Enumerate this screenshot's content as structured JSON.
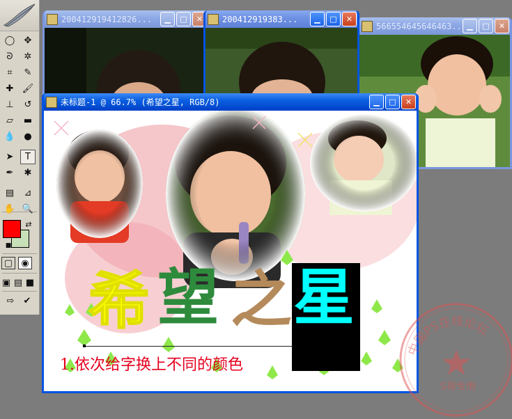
{
  "toolbox": {
    "tools": [
      {
        "name": "marquee-tool-icon",
        "glyph": "◯"
      },
      {
        "name": "move-tool-icon",
        "glyph": "✥"
      },
      {
        "name": "lasso-tool-icon",
        "glyph": "ᘐ"
      },
      {
        "name": "magic-wand-tool-icon",
        "glyph": "✲"
      },
      {
        "name": "crop-tool-icon",
        "glyph": "⌗"
      },
      {
        "name": "slice-tool-icon",
        "glyph": "✎"
      },
      {
        "name": "healing-brush-icon",
        "glyph": "✚"
      },
      {
        "name": "brush-tool-icon",
        "glyph": "🖌"
      },
      {
        "name": "clone-stamp-icon",
        "glyph": "⊥"
      },
      {
        "name": "history-brush-icon",
        "glyph": "↺"
      },
      {
        "name": "eraser-tool-icon",
        "glyph": "▱"
      },
      {
        "name": "gradient-tool-icon",
        "glyph": "▬"
      },
      {
        "name": "blur-tool-icon",
        "glyph": "💧"
      },
      {
        "name": "dodge-tool-icon",
        "glyph": "●"
      },
      {
        "name": "path-selection-icon",
        "glyph": "➤"
      },
      {
        "name": "type-tool-icon",
        "glyph": "T"
      },
      {
        "name": "pen-tool-icon",
        "glyph": "✒"
      },
      {
        "name": "custom-shape-icon",
        "glyph": "✱"
      },
      {
        "name": "notes-tool-icon",
        "glyph": "▤"
      },
      {
        "name": "eyedropper-tool-icon",
        "glyph": "⊿"
      },
      {
        "name": "hand-tool-icon",
        "glyph": "✋"
      },
      {
        "name": "zoom-tool-icon",
        "glyph": "🔍"
      }
    ],
    "foreground_color": "#ff0000",
    "background_color": "#c8e0b8"
  },
  "windows": {
    "photo1": {
      "title": "200412919412826..."
    },
    "photo2": {
      "title": "200412919383..."
    },
    "photo3": {
      "title": "566554645646463..."
    },
    "main": {
      "title": "未标题-1 @ 66.7% (希望之星, RGB/8)"
    }
  },
  "canvas": {
    "headline_chars": [
      "希",
      "望",
      "之",
      "星"
    ],
    "headline_colors": [
      "#ffff00",
      "#2e8b3c",
      "#b58a5a",
      "#00ffff"
    ],
    "caption": "1.依次给字换上不同的颜色"
  },
  "stamp": {
    "ring_text": "中国PS在线论坛",
    "center_text": "S哥专用"
  }
}
